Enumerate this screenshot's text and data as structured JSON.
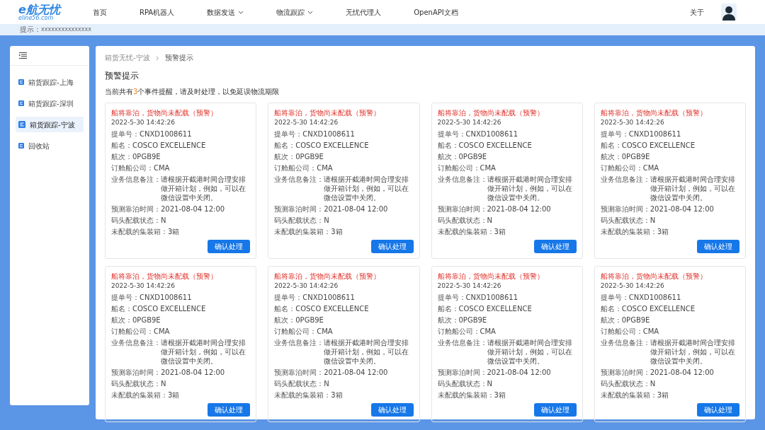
{
  "logo": {
    "name": "e航无忧",
    "domain": "eline56.com"
  },
  "nav": [
    {
      "label": "首页",
      "dropdown": false
    },
    {
      "label": "RPA机器人",
      "dropdown": false
    },
    {
      "label": "数据发送",
      "dropdown": true
    },
    {
      "label": "物流跟踪",
      "dropdown": true
    },
    {
      "label": "无忧代理人",
      "dropdown": false
    },
    {
      "label": "OpenAPI文档",
      "dropdown": false
    }
  ],
  "about": "关于",
  "hint": {
    "label": "提示：",
    "text": "xxxxxxxxxxxxxxx"
  },
  "sidebar": {
    "items": [
      {
        "label": "箱货跟踪-上海",
        "selected": false
      },
      {
        "label": "箱货跟踪-深圳",
        "selected": false
      },
      {
        "label": "箱货跟踪-宁波",
        "selected": true
      },
      {
        "label": "回收站",
        "selected": false
      }
    ]
  },
  "breadcrumb": [
    "箱货无忧-宁波",
    "预警提示"
  ],
  "page_title": "预警提示",
  "summary": {
    "before": "当前共有",
    "count": "3",
    "after": "个事件提醒，请及时处理，以免延误物流期限"
  },
  "cards": [
    {
      "title": "船将靠泊，货物尚未配载（预警）",
      "time": "2022-5-30 14:42:26",
      "fields": [
        {
          "label": "提单号：",
          "value": "CNXD1008611"
        },
        {
          "label": "船名：",
          "value": "COSCO EXCELLENCE"
        },
        {
          "label": "航次：",
          "value": "0PGB9E"
        },
        {
          "label": "订舱船公司：",
          "value": "CMA"
        },
        {
          "label": "业务信息备注：",
          "value": "请根据开截港时间合理安排做开箱计划，例如，可以在微信设置中关闭。"
        },
        {
          "label": "预测靠泊时间：",
          "value": "2021-08-04 12:00"
        },
        {
          "label": "码头配载状态：",
          "value": "N"
        },
        {
          "label": "未配载的集装箱：",
          "value": "3箱"
        }
      ],
      "button": "确认处理"
    },
    {
      "title": "船将靠泊，货物尚未配载（预警）",
      "time": "2022-5-30 14:42:26",
      "fields": [
        {
          "label": "提单号：",
          "value": "CNXD1008611"
        },
        {
          "label": "船名：",
          "value": "COSCO EXCELLENCE"
        },
        {
          "label": "航次：",
          "value": "0PGB9E"
        },
        {
          "label": "订舱船公司：",
          "value": "CMA"
        },
        {
          "label": "业务信息备注：",
          "value": "请根据开截港时间合理安排做开箱计划，例如，可以在微信设置中关闭。"
        },
        {
          "label": "预测靠泊时间：",
          "value": "2021-08-04 12:00"
        },
        {
          "label": "码头配载状态：",
          "value": "N"
        },
        {
          "label": "未配载的集装箱：",
          "value": "3箱"
        }
      ],
      "button": "确认处理"
    },
    {
      "title": "船将靠泊，货物尚未配载（预警）",
      "time": "2022-5-30 14:42:26",
      "fields": [
        {
          "label": "提单号：",
          "value": "CNXD1008611"
        },
        {
          "label": "船名：",
          "value": "COSCO EXCELLENCE"
        },
        {
          "label": "航次：",
          "value": "0PGB9E"
        },
        {
          "label": "订舱船公司：",
          "value": "CMA"
        },
        {
          "label": "业务信息备注：",
          "value": "请根据开截港时间合理安排做开箱计划，例如，可以在微信设置中关闭。"
        },
        {
          "label": "预测靠泊时间：",
          "value": "2021-08-04 12:00"
        },
        {
          "label": "码头配载状态：",
          "value": "N"
        },
        {
          "label": "未配载的集装箱：",
          "value": "3箱"
        }
      ],
      "button": "确认处理"
    },
    {
      "title": "船将靠泊，货物尚未配载（预警）",
      "time": "2022-5-30 14:42:26",
      "fields": [
        {
          "label": "提单号：",
          "value": "CNXD1008611"
        },
        {
          "label": "船名：",
          "value": "COSCO EXCELLENCE"
        },
        {
          "label": "航次：",
          "value": "0PGB9E"
        },
        {
          "label": "订舱船公司：",
          "value": "CMA"
        },
        {
          "label": "业务信息备注：",
          "value": "请根据开截港时间合理安排做开箱计划，例如，可以在微信设置中关闭。"
        },
        {
          "label": "预测靠泊时间：",
          "value": "2021-08-04 12:00"
        },
        {
          "label": "码头配载状态：",
          "value": "N"
        },
        {
          "label": "未配载的集装箱：",
          "value": "3箱"
        }
      ],
      "button": "确认处理"
    },
    {
      "title": "船将靠泊，货物尚未配载（预警）",
      "time": "2022-5-30 14:42:26",
      "fields": [
        {
          "label": "提单号：",
          "value": "CNXD1008611"
        },
        {
          "label": "船名：",
          "value": "COSCO EXCELLENCE"
        },
        {
          "label": "航次：",
          "value": "0PGB9E"
        },
        {
          "label": "订舱船公司：",
          "value": "CMA"
        },
        {
          "label": "业务信息备注：",
          "value": "请根据开截港时间合理安排做开箱计划，例如，可以在微信设置中关闭。"
        },
        {
          "label": "预测靠泊时间：",
          "value": "2021-08-04 12:00"
        },
        {
          "label": "码头配载状态：",
          "value": "N"
        },
        {
          "label": "未配载的集装箱：",
          "value": "3箱"
        }
      ],
      "button": "确认处理"
    },
    {
      "title": "船将靠泊，货物尚未配载（预警）",
      "time": "2022-5-30 14:42:26",
      "fields": [
        {
          "label": "提单号：",
          "value": "CNXD1008611"
        },
        {
          "label": "船名：",
          "value": "COSCO EXCELLENCE"
        },
        {
          "label": "航次：",
          "value": "0PGB9E"
        },
        {
          "label": "订舱船公司：",
          "value": "CMA"
        },
        {
          "label": "业务信息备注：",
          "value": "请根据开截港时间合理安排做开箱计划，例如，可以在微信设置中关闭。"
        },
        {
          "label": "预测靠泊时间：",
          "value": "2021-08-04 12:00"
        },
        {
          "label": "码头配载状态：",
          "value": "N"
        },
        {
          "label": "未配载的集装箱：",
          "value": "3箱"
        }
      ],
      "button": "确认处理"
    },
    {
      "title": "船将靠泊，货物尚未配载（预警）",
      "time": "2022-5-30 14:42:26",
      "fields": [
        {
          "label": "提单号：",
          "value": "CNXD1008611"
        },
        {
          "label": "船名：",
          "value": "COSCO EXCELLENCE"
        },
        {
          "label": "航次：",
          "value": "0PGB9E"
        },
        {
          "label": "订舱船公司：",
          "value": "CMA"
        },
        {
          "label": "业务信息备注：",
          "value": "请根据开截港时间合理安排做开箱计划，例如，可以在微信设置中关闭。"
        },
        {
          "label": "预测靠泊时间：",
          "value": "2021-08-04 12:00"
        },
        {
          "label": "码头配载状态：",
          "value": "N"
        },
        {
          "label": "未配载的集装箱：",
          "value": "3箱"
        }
      ],
      "button": "确认处理"
    },
    {
      "title": "船将靠泊，货物尚未配载（预警）",
      "time": "2022-5-30 14:42:26",
      "fields": [
        {
          "label": "提单号：",
          "value": "CNXD1008611"
        },
        {
          "label": "船名：",
          "value": "COSCO EXCELLENCE"
        },
        {
          "label": "航次：",
          "value": "0PGB9E"
        },
        {
          "label": "订舱船公司：",
          "value": "CMA"
        },
        {
          "label": "业务信息备注：",
          "value": "请根据开截港时间合理安排做开箱计划，例如，可以在微信设置中关闭。"
        },
        {
          "label": "预测靠泊时间：",
          "value": "2021-08-04 12:00"
        },
        {
          "label": "码头配载状态：",
          "value": "N"
        },
        {
          "label": "未配载的集装箱：",
          "value": "3箱"
        }
      ],
      "button": "确认处理"
    }
  ]
}
